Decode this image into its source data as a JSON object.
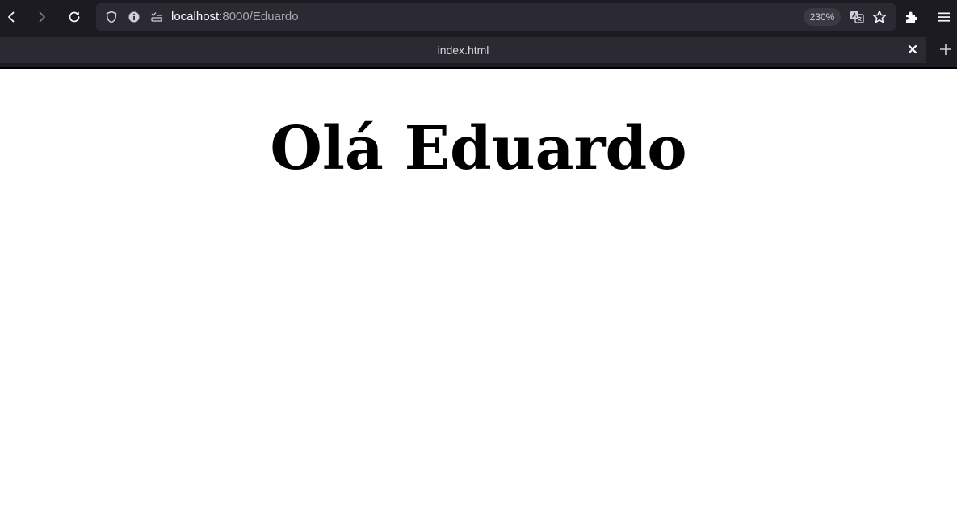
{
  "browser": {
    "url_host": "localhost",
    "url_rest": ":8000/Eduardo",
    "zoom": "230%",
    "tab_title": "index.html",
    "icons": {
      "back": "back-arrow-icon",
      "forward": "forward-arrow-icon",
      "reload": "reload-icon",
      "shield": "shield-icon",
      "info": "info-icon",
      "permissions": "permissions-icon",
      "translate": "translate-icon",
      "bookmark": "star-icon",
      "extensions": "puzzle-icon",
      "menu": "hamburger-menu-icon",
      "close_tab": "close-icon",
      "new_tab": "plus-icon"
    }
  },
  "page": {
    "heading": "Olá Eduardo"
  },
  "colors": {
    "chrome_bg": "#1c1b22",
    "urlbar_bg": "#2b2a33",
    "page_bg": "#ffffff",
    "text": "#000000"
  }
}
